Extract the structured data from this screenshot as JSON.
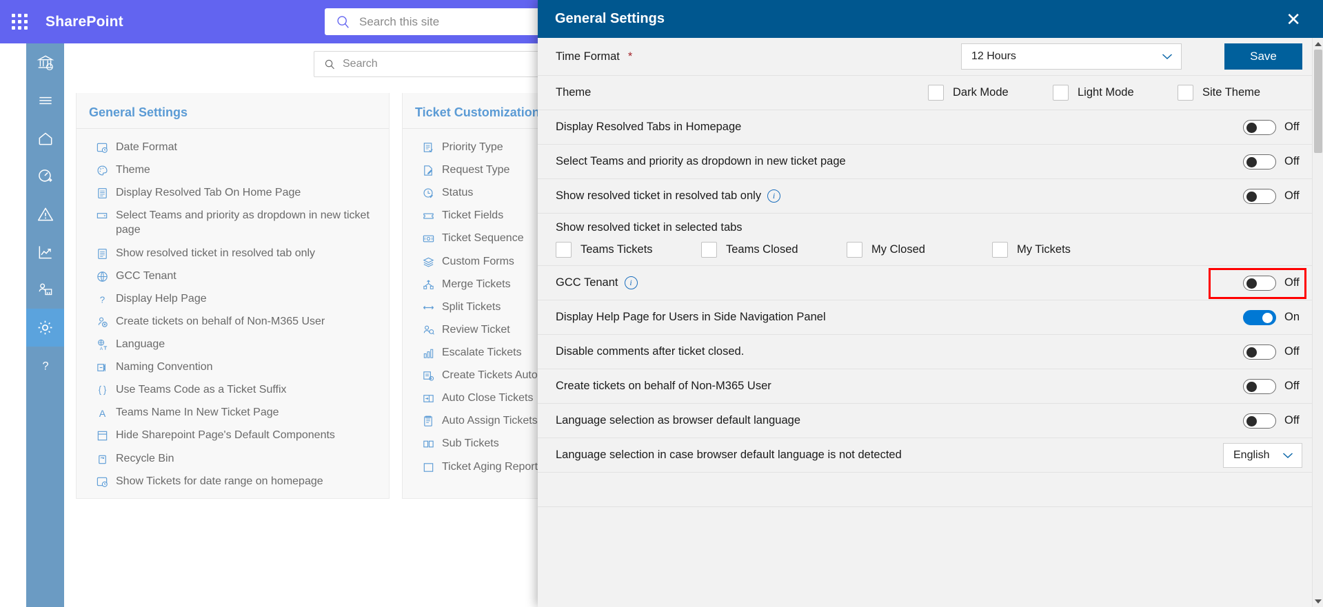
{
  "suitebar": {
    "app_title": "SharePoint",
    "waffle_name": "app-launcher",
    "search_placeholder": "Search this site"
  },
  "rail": {
    "items": [
      {
        "name": "bank-institution-icon",
        "label": "Institution"
      },
      {
        "name": "hamburger-menu-icon",
        "label": "Menu"
      },
      {
        "name": "home-icon",
        "label": "Home"
      },
      {
        "name": "dashboard-gauge-icon",
        "label": "Dashboard"
      },
      {
        "name": "alert-warning-icon",
        "label": "Alerts"
      },
      {
        "name": "analytics-chart-icon",
        "label": "Analytics"
      },
      {
        "name": "users-group-icon",
        "label": "Teams"
      },
      {
        "name": "settings-gear-icon",
        "label": "Settings",
        "active": true
      },
      {
        "name": "help-question-icon",
        "label": "Help"
      }
    ]
  },
  "page": {
    "search_placeholder": "Search",
    "cards": [
      {
        "title": "General Settings",
        "items": [
          {
            "icon": "date-format-icon",
            "label": "Date Format"
          },
          {
            "icon": "theme-palette-icon",
            "label": "Theme"
          },
          {
            "icon": "document-icon",
            "label": "Display Resolved Tab On Home Page"
          },
          {
            "icon": "dropdown-icon",
            "label": "Select Teams and priority as dropdown in new ticket page"
          },
          {
            "icon": "document-icon",
            "label": "Show resolved ticket in resolved tab only"
          },
          {
            "icon": "globe-icon",
            "label": "GCC Tenant"
          },
          {
            "icon": "question-icon",
            "label": "Display Help Page"
          },
          {
            "icon": "user-block-icon",
            "label": "Create tickets on behalf of Non-M365 User"
          },
          {
            "icon": "translate-icon",
            "label": "Language"
          },
          {
            "icon": "naming-convention-icon",
            "label": "Naming Convention"
          },
          {
            "icon": "braces-icon",
            "label": "Use Teams Code as a Ticket Suffix"
          },
          {
            "icon": "letter-a-icon",
            "label": "Teams Name In New Ticket Page"
          },
          {
            "icon": "page-layout-icon",
            "label": "Hide Sharepoint Page's Default Components"
          },
          {
            "icon": "recycle-bin-icon",
            "label": "Recycle Bin"
          },
          {
            "icon": "date-range-icon",
            "label": "Show Tickets for date range on homepage"
          }
        ]
      },
      {
        "title": "Ticket Customizations",
        "items": [
          {
            "icon": "priority-list-icon",
            "label": "Priority Type"
          },
          {
            "icon": "request-edit-icon",
            "label": "Request Type"
          },
          {
            "icon": "clock-status-icon",
            "label": "Status"
          },
          {
            "icon": "ticket-icon",
            "label": "Ticket Fields"
          },
          {
            "icon": "ticket-sequence-icon",
            "label": "Ticket Sequence"
          },
          {
            "icon": "layers-icon",
            "label": "Custom Forms"
          },
          {
            "icon": "merge-icon",
            "label": "Merge Tickets"
          },
          {
            "icon": "split-arrows-icon",
            "label": "Split Tickets"
          },
          {
            "icon": "review-user-icon",
            "label": "Review Ticket"
          },
          {
            "icon": "escalate-chart-icon",
            "label": "Escalate Tickets"
          },
          {
            "icon": "automation-icon",
            "label": "Create Tickets Automatically"
          },
          {
            "icon": "auto-close-icon",
            "label": "Auto Close Tickets"
          },
          {
            "icon": "auto-assign-icon",
            "label": "Auto Assign Tickets"
          },
          {
            "icon": "sub-tickets-icon",
            "label": "Sub Tickets"
          },
          {
            "icon": "aging-report-icon",
            "label": "Ticket Aging Reports"
          }
        ]
      }
    ]
  },
  "panel": {
    "title": "General Settings",
    "close_label": "✕",
    "save_label": "Save",
    "time_format": {
      "label": "Time Format",
      "required_marker": "*",
      "value": "12 Hours"
    },
    "theme": {
      "label": "Theme",
      "options": [
        {
          "label": "Dark Mode",
          "checked": false
        },
        {
          "label": "Light Mode",
          "checked": false
        },
        {
          "label": "Site Theme",
          "checked": false
        }
      ]
    },
    "rows": [
      {
        "label": "Display Resolved Tabs in Homepage",
        "state": "Off",
        "on": false
      },
      {
        "label": "Select Teams and priority as dropdown in new ticket page",
        "state": "Off",
        "on": false
      },
      {
        "label": "Show resolved ticket in resolved tab only",
        "state": "Off",
        "on": false,
        "info": true
      }
    ],
    "selected_tabs": {
      "label": "Show resolved ticket in selected tabs",
      "options": [
        {
          "label": "Teams Tickets",
          "checked": false
        },
        {
          "label": "Teams Closed",
          "checked": false
        },
        {
          "label": "My Closed",
          "checked": false
        },
        {
          "label": "My Tickets",
          "checked": false
        }
      ]
    },
    "gcc": {
      "label": "GCC Tenant",
      "state": "Off",
      "on": false,
      "info": true,
      "highlighted": true
    },
    "rows2": [
      {
        "label": "Display Help Page for Users in Side Navigation Panel",
        "state": "On",
        "on": true
      },
      {
        "label": "Disable comments after ticket closed.",
        "state": "Off",
        "on": false
      },
      {
        "label": "Create tickets on behalf of Non-M365 User",
        "state": "Off",
        "on": false
      },
      {
        "label": "Language selection as browser default language",
        "state": "Off",
        "on": false
      }
    ],
    "language_fallback": {
      "label": "Language selection in case browser default language is not detected",
      "value": "English"
    }
  },
  "colors": {
    "suitebar": "#6264f0",
    "panel_header": "#00578f",
    "save_button": "#00609c",
    "rail": "#6b9bc3",
    "rail_active": "#5ba3dd",
    "card_title": "#5b9bd5",
    "highlight": "#ff0000",
    "toggle_on": "#0078d4"
  }
}
